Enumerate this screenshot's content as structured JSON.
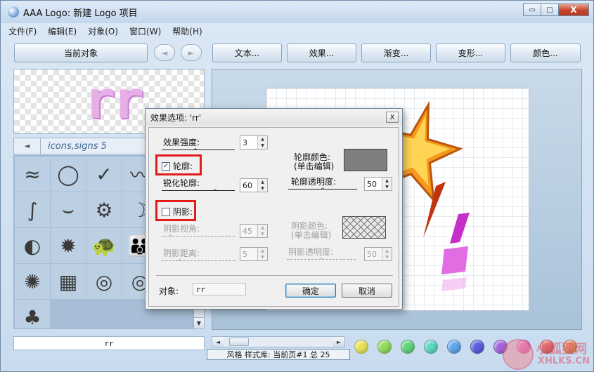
{
  "window": {
    "title": "AAA Logo: 新建 Logo 项目",
    "min_symbol": "▭",
    "max_symbol": "□",
    "close_symbol": "X"
  },
  "menu": [
    "文件(F)",
    "编辑(E)",
    "对象(O)",
    "窗口(W)",
    "帮助(H)"
  ],
  "toolbar": {
    "current_object": "当前对象",
    "prev_symbol": "◄",
    "next_symbol": "►",
    "text": "文本...",
    "effects": "效果...",
    "gradient": "渐变...",
    "transform": "变形...",
    "color": "颜色..."
  },
  "preview": {
    "text": "rr"
  },
  "gallery": {
    "title": "icons,signs 5",
    "left_arrow": "◄",
    "scroll_down": "▼",
    "icons": [
      "≈",
      "◯",
      "✓",
      "〰",
      "☕",
      "∫",
      "⌣",
      "⚙",
      "☽",
      "⊘",
      "◐",
      "✹",
      "🐢",
      "👪",
      "✿",
      "✺",
      "▦",
      "◎",
      "◎",
      "♣",
      "♣"
    ]
  },
  "object_name": "rr",
  "status": "风格 样式库: 当前页#1 总 25",
  "hscroll": {
    "left": "◄",
    "right": "►"
  },
  "swatches": [
    "#e8e55a",
    "#8edc5e",
    "#62d57e",
    "#5fd8c4",
    "#62a6e9",
    "#5a5ee0",
    "#a164dd",
    "#e065c8",
    "#e46a6a",
    "#e9915c"
  ],
  "watermark": {
    "line1": "小狐狸网",
    "line2": "XHLKS.CN"
  },
  "dialog": {
    "title": "效果选项: 'rr'",
    "close": "X",
    "effect_strength_label": "效果强度:",
    "effect_strength_value": "3",
    "outline_label": "轮廓:",
    "outline_checked": true,
    "outline_color_label": "轮廓颜色:\n(单击编辑)",
    "outline_color": "#7f7f7f",
    "sharpen_outline_label": "锐化轮廓:",
    "sharpen_outline_value": "60",
    "outline_opacity_label": "轮廓透明度:",
    "outline_opacity_value": "50",
    "shadow_label": "阴影:",
    "shadow_checked": false,
    "shadow_angle_label": "阴影视角:",
    "shadow_angle_value": "45",
    "shadow_color_label": "阴影颜色:\n(单击编辑)",
    "shadow_distance_label": "阴影距离:",
    "shadow_distance_value": "5",
    "shadow_opacity_label": "阴影透明度:",
    "shadow_opacity_value": "50",
    "object_label": "对象:",
    "object_value": "rr",
    "ok": "确定",
    "cancel": "取消",
    "highlight_color": "#e21b1b"
  }
}
